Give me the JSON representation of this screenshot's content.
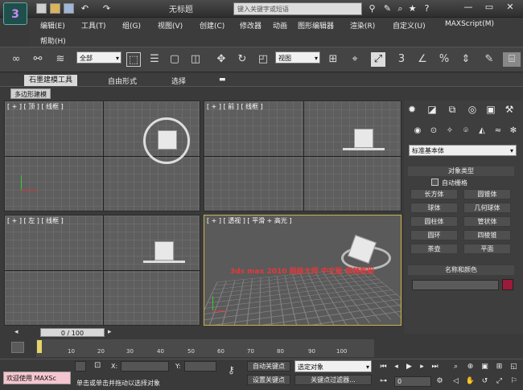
{
  "app": {
    "logo": "3",
    "title": "无标题",
    "search_placeholder": "键入关键字或短语"
  },
  "menu": [
    "编辑(E)",
    "工具(T)",
    "组(G)",
    "视图(V)",
    "创建(C)",
    "修改器",
    "动画",
    "图形编辑器",
    "渲染(R)",
    "自定义(U)",
    "MAXScript(M)",
    "帮助(H)"
  ],
  "toolbar": {
    "filter_value": "全部",
    "refcoord_value": "视图",
    "num3": "3",
    "pct": "%"
  },
  "ribbon_tabs": [
    "石墨建模工具",
    "自由形式",
    "选择"
  ],
  "ribbon_sub": "多边形建模",
  "viewports": {
    "top": "[ + ] [ 顶 ] [ 线框 ]",
    "front": "[ + ] [ 前 ] [ 线框 ]",
    "left": "[ + ] [ 左 ] [ 线框 ]",
    "persp": "[ + ] [ 透视 ] [ 平滑 + 高光 ]"
  },
  "command_panel": {
    "dropdown": "标准基本体",
    "rollout1": "对象类型",
    "autogrid": "自动栅格",
    "objects": [
      "长方体",
      "圆锥体",
      "球体",
      "几何球体",
      "圆柱体",
      "管状体",
      "圆环",
      "四棱锥",
      "茶壶",
      "平面"
    ],
    "rollout2": "名称和颜色",
    "colors": {
      "swatch": "#9b1a3a"
    }
  },
  "timeline": {
    "frame": "0 / 100",
    "ticks": [
      "10",
      "20",
      "30",
      "40",
      "50",
      "60",
      "70",
      "80",
      "90",
      "100"
    ]
  },
  "status": {
    "welcome": "欢迎使用 MAXSc",
    "prompt": "单击或单击并拖动以选择对象",
    "x": "X:",
    "y": "Y:",
    "autokey": "自动关键点",
    "setkey": "设置关键点",
    "selected": "选定对象",
    "keyfilter": "关键点过滤器...",
    "frame_field": "0"
  },
  "watermark": "3ds max 2010 超级大师 中文版 视频教程"
}
